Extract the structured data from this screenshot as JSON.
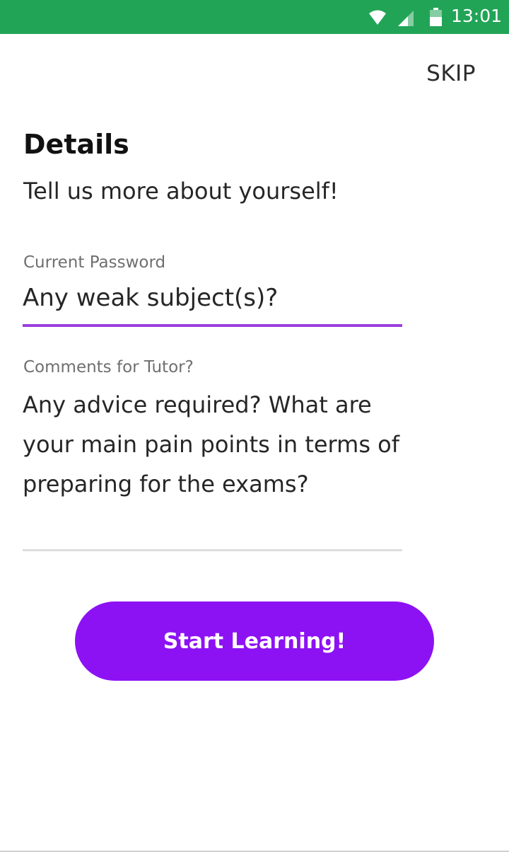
{
  "status_bar": {
    "time": "13:01",
    "color": "#22a457",
    "icons": [
      "wifi-icon",
      "signal-icon",
      "battery-icon"
    ]
  },
  "header": {
    "skip_label": "SKIP"
  },
  "main": {
    "title": "Details",
    "subtitle": "Tell us more about yourself!",
    "fields": [
      {
        "label": "Current Password",
        "placeholder": "Any weak subject(s)?",
        "value": ""
      },
      {
        "label": "Comments for Tutor?",
        "placeholder": "Any advice required? What are your main pain points in terms of preparing for the exams?",
        "value": ""
      }
    ],
    "cta_label": "Start Learning!"
  },
  "colors": {
    "accent": "#8c12f4",
    "focus_underline": "#9b3fde",
    "status_bar": "#22a457"
  }
}
